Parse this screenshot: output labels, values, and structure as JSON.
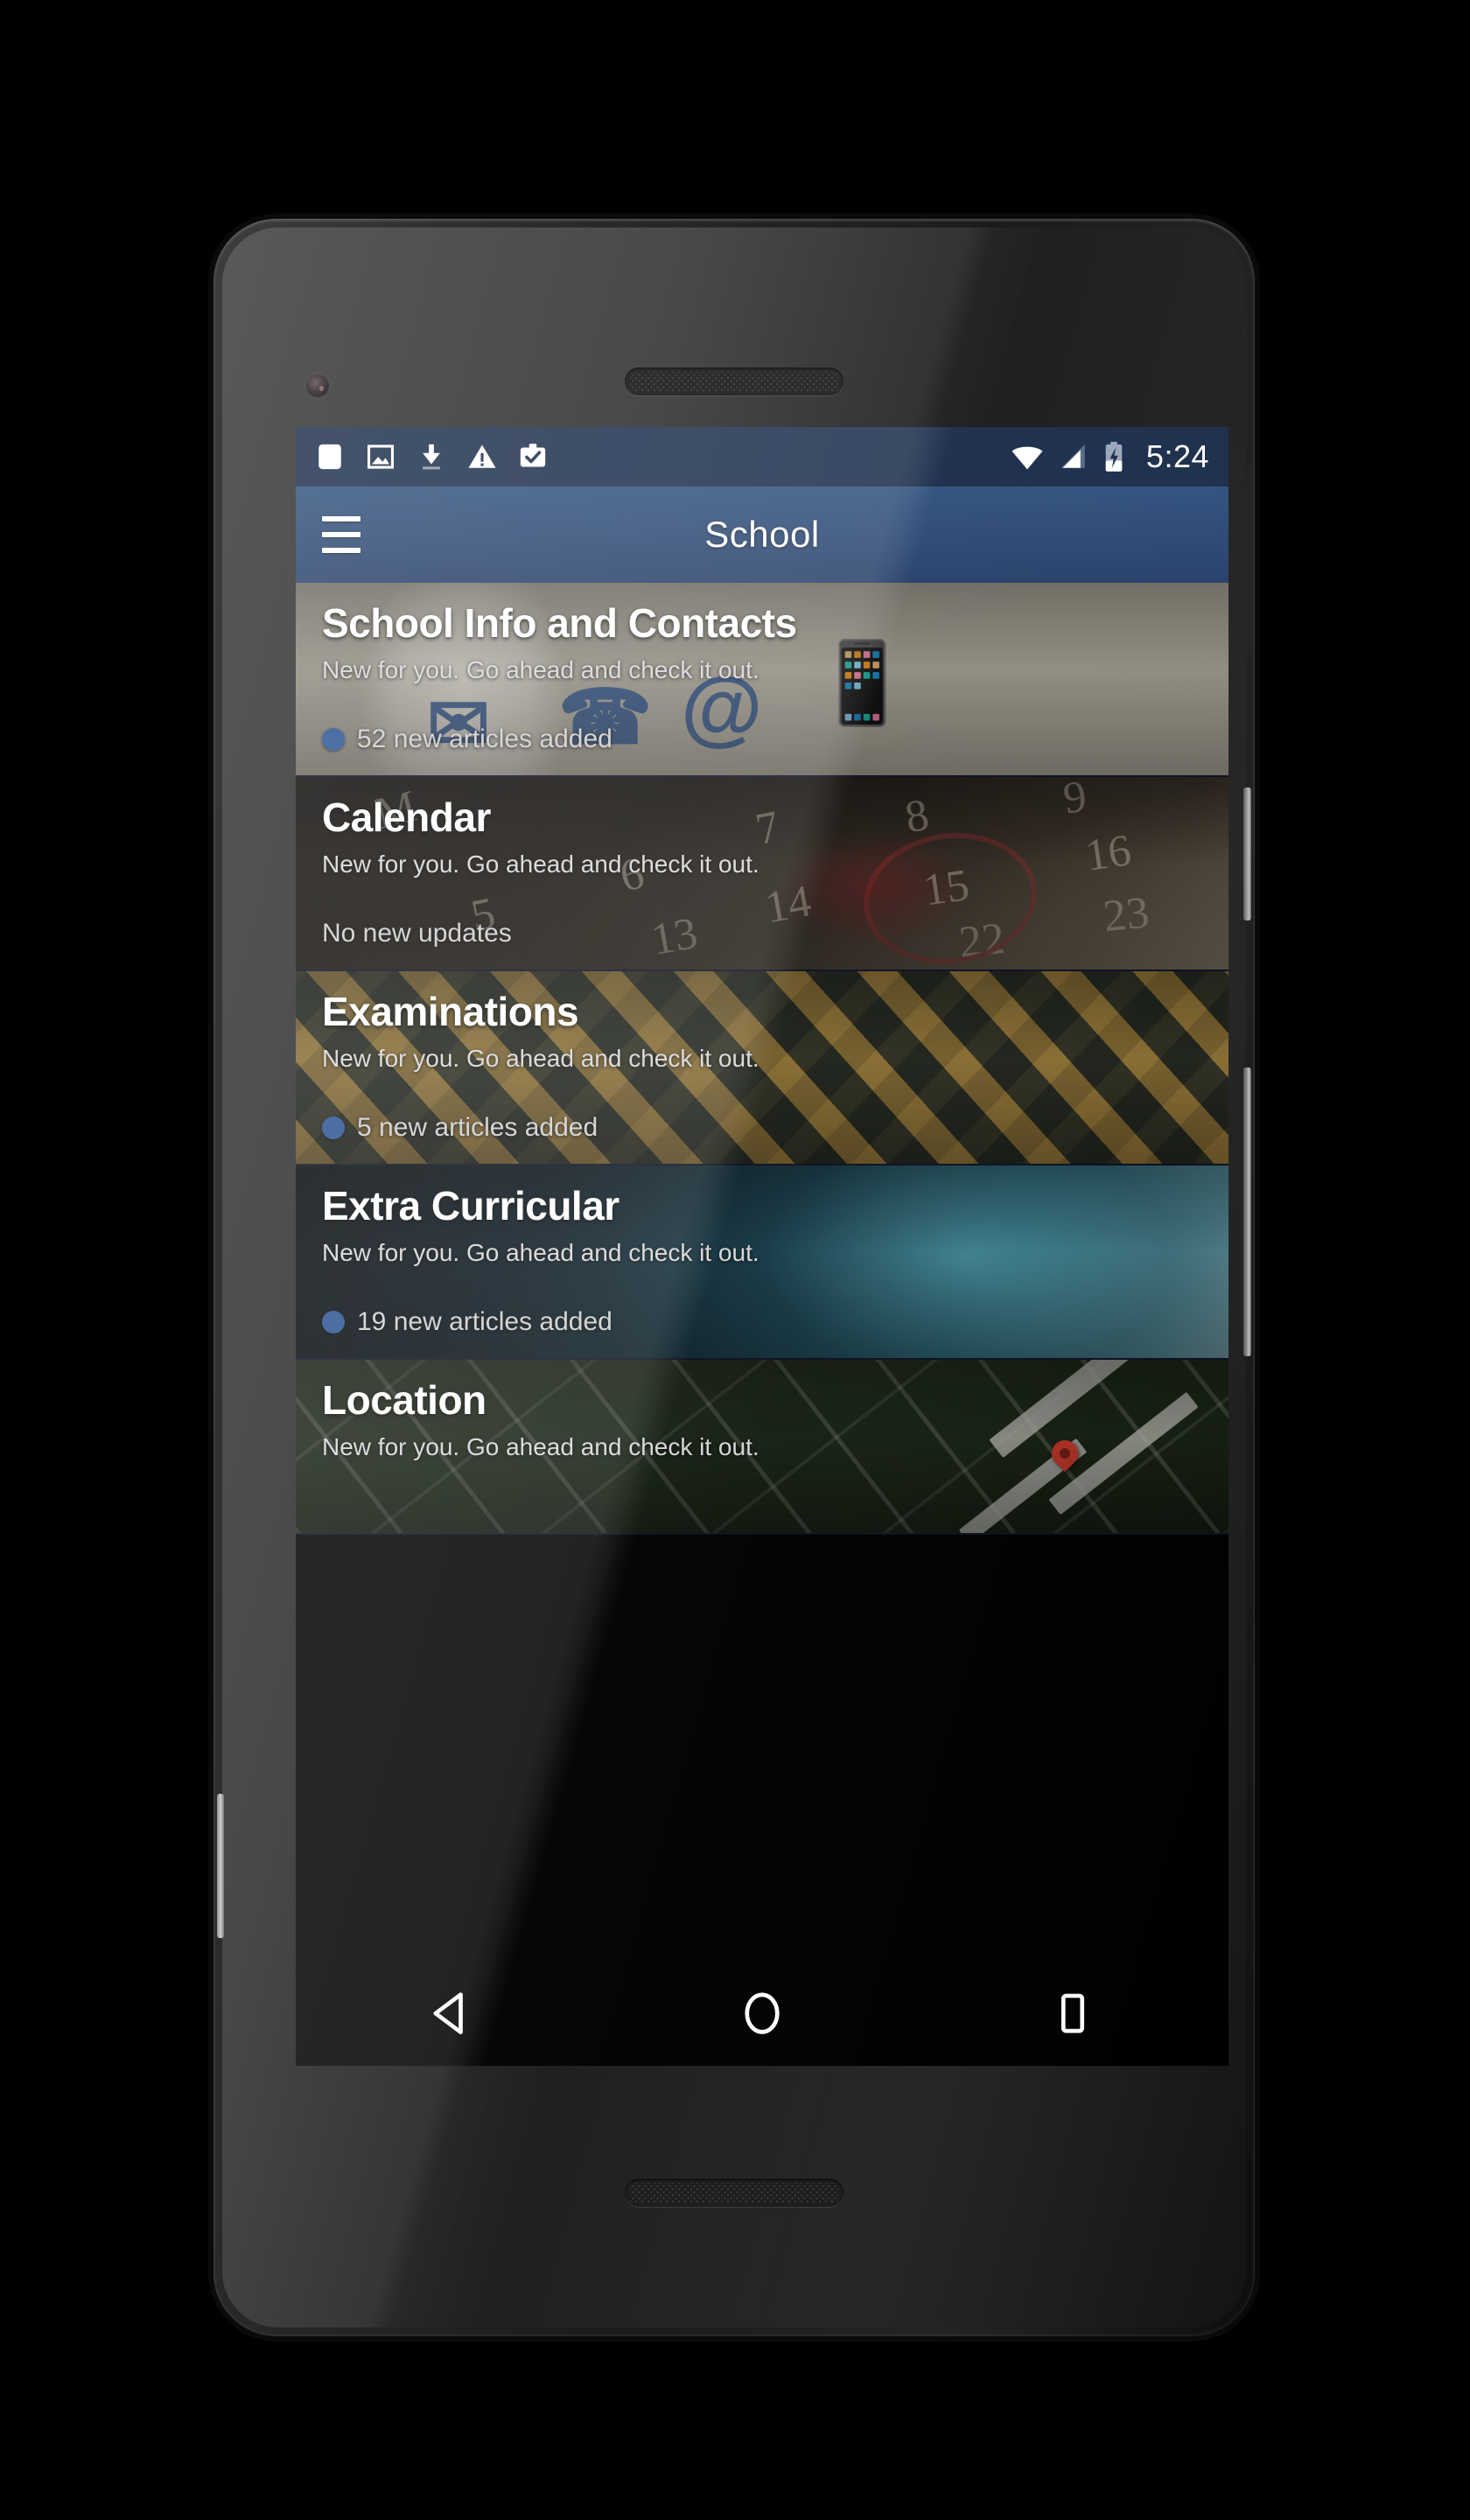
{
  "device": {
    "camera": "front-camera",
    "earpiece": "earpiece-speaker",
    "bottom_speaker": "bottom-speaker",
    "power_button": "power-button",
    "volume_button": "volume-rocker"
  },
  "statusbar": {
    "time": "5:24",
    "background": "#1c2e4c",
    "left_icons": [
      {
        "name": "blank-notification-icon",
        "glyph": "rounded-square"
      },
      {
        "name": "image-notification-icon",
        "glyph": "photo"
      },
      {
        "name": "download-notification-icon",
        "glyph": "download-arrow"
      },
      {
        "name": "warning-notification-icon",
        "glyph": "warning-triangle"
      },
      {
        "name": "work-profile-icon",
        "glyph": "briefcase-check"
      }
    ],
    "right_icons": [
      {
        "name": "wifi-icon",
        "glyph": "wifi-full"
      },
      {
        "name": "cellular-signal-icon",
        "glyph": "signal-bars"
      },
      {
        "name": "battery-charging-icon",
        "glyph": "battery-bolt"
      }
    ]
  },
  "appbar": {
    "title": "School",
    "menu_label": "Open navigation drawer",
    "background": "#2c4873",
    "accent": "#2b5391"
  },
  "cards": [
    {
      "title": "School Info and Contacts",
      "subtitle": "New for you. Go ahead and check it out.",
      "status": "52 new articles added",
      "has_dot": true,
      "dot_color": "#2b5391",
      "image": "contact-icons-on-keyboard-keys"
    },
    {
      "title": "Calendar",
      "subtitle": "New for you. Go ahead and check it out.",
      "status": "No new updates",
      "has_dot": false,
      "dot_color": "#2b5391",
      "image": "calendar-page-with-red-circled-date"
    },
    {
      "title": "Examinations",
      "subtitle": "New for you. Go ahead and check it out.",
      "status": "5 new articles added",
      "has_dot": true,
      "dot_color": "#2b5391",
      "image": "exam-hall-with-rows-of-desks"
    },
    {
      "title": "Extra Curricular",
      "subtitle": "New for you. Go ahead and check it out.",
      "status": "19 new articles added",
      "has_dot": true,
      "dot_color": "#2b5391",
      "image": "teal-toned-sports-activity"
    },
    {
      "title": "Location",
      "subtitle": "New for you. Go ahead and check it out.",
      "status": "",
      "has_dot": false,
      "dot_color": "#2b5391",
      "image": "satellite-map-with-red-pin"
    }
  ],
  "navbar": {
    "buttons": [
      {
        "name": "nav-back-button",
        "glyph": "triangle-left"
      },
      {
        "name": "nav-home-button",
        "glyph": "circle"
      },
      {
        "name": "nav-recents-button",
        "glyph": "square"
      }
    ]
  }
}
